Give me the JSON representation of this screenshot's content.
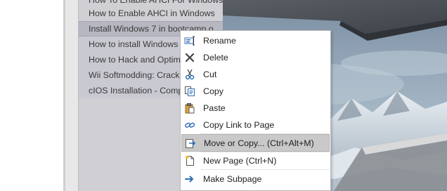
{
  "page_list": {
    "items": [
      {
        "label": "How To Enable AHCI For Windows",
        "selected": false
      },
      {
        "label": "How to Enable AHCI in Windows",
        "selected": false
      },
      {
        "label": "Install Windows 7 in bootcamp o",
        "selected": true
      },
      {
        "label": "How to install Windows",
        "selected": true
      },
      {
        "label": "How to Hack and Optim",
        "selected": true
      },
      {
        "label": "Wii Softmodding: Cracki",
        "selected": true
      },
      {
        "label": "cIOS Installation - Comp",
        "selected": true
      }
    ]
  },
  "context_menu": {
    "items": [
      {
        "name": "rename",
        "label": "Rename",
        "icon": "rename-icon"
      },
      {
        "name": "delete",
        "label": "Delete",
        "icon": "delete-icon"
      },
      {
        "name": "cut",
        "label": "Cut",
        "icon": "scissors-icon"
      },
      {
        "name": "copy",
        "label": "Copy",
        "icon": "copy-icon"
      },
      {
        "name": "paste",
        "label": "Paste",
        "icon": "paste-icon"
      },
      {
        "name": "copy-link",
        "label": "Copy Link to Page",
        "icon": "link-icon"
      },
      {
        "name": "move-or-copy",
        "label": "Move or Copy...  (Ctrl+Alt+M)",
        "icon": "move-page-icon",
        "highlighted": true
      },
      {
        "name": "new-page",
        "label": "New Page  (Ctrl+N)",
        "icon": "new-page-icon"
      },
      {
        "name": "make-subpage",
        "label": "Make Subpage",
        "icon": "arrow-right-icon"
      }
    ]
  },
  "colors": {
    "panel_bg": "#cfcfd4",
    "selected_bg": "#b7b7c1",
    "menu_highlight": "#c9c9c9",
    "accent_blue": "#2e6db4"
  }
}
